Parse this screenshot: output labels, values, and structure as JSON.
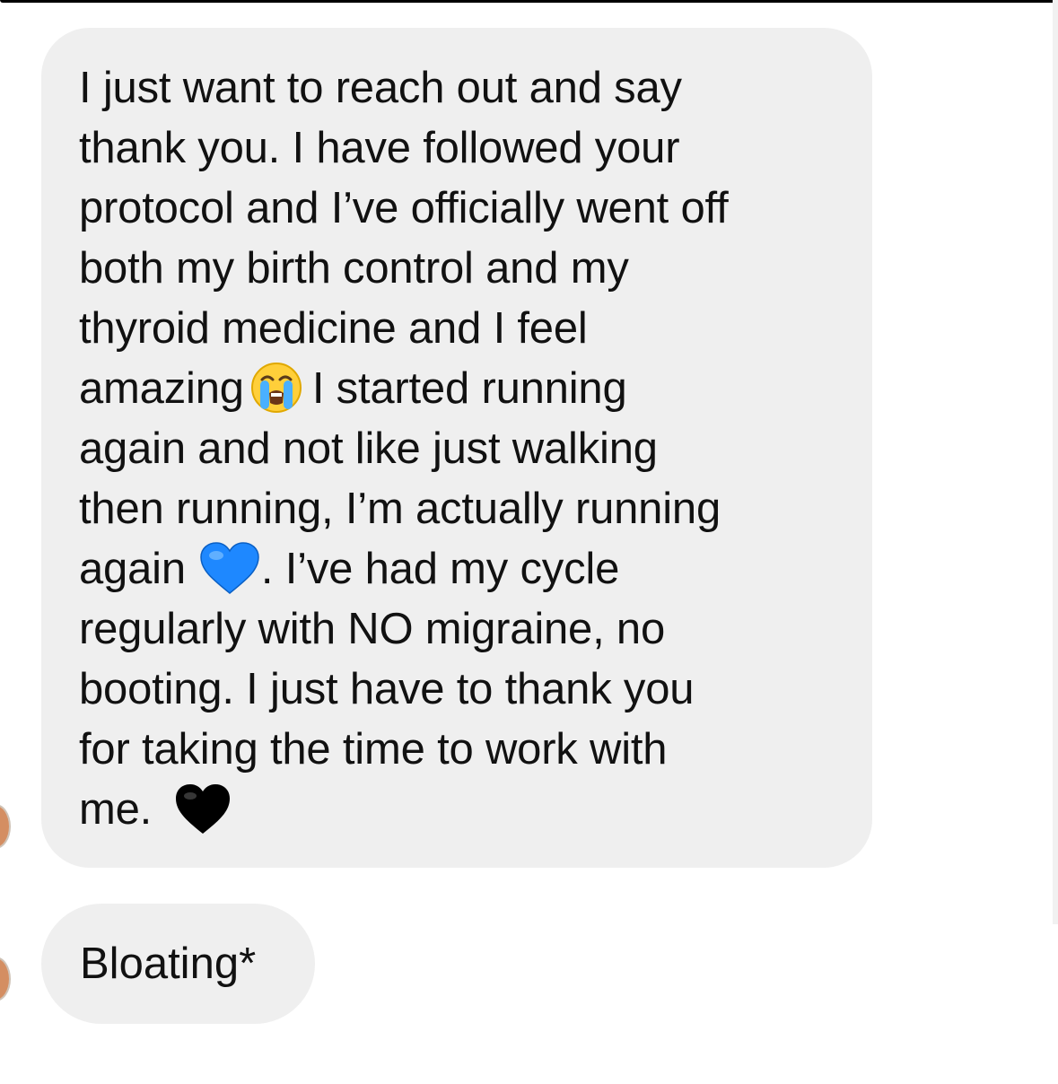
{
  "messages": [
    {
      "lines": [
        "I just want to reach out and say",
        "thank you. I have followed your",
        "protocol and I’ve officially went off",
        "both my birth control and my",
        "thyroid medicine and I feel",
        "amazing",
        "I started running",
        "again and not like just walking",
        "then running, I’m actually running",
        "again",
        ". I’ve had my cycle",
        "regularly with NO migraine, no",
        "booting. I just have to thank you",
        "for taking the time to work with",
        "me."
      ],
      "emojis": [
        "loudly-crying-face-icon",
        "blue-heart-icon",
        "black-heart-icon"
      ]
    },
    {
      "text": "Bloating*"
    }
  ],
  "colors": {
    "bubble": "#efefef",
    "text": "#111111",
    "blue_heart": "#1e88ff",
    "black_heart": "#000000"
  }
}
